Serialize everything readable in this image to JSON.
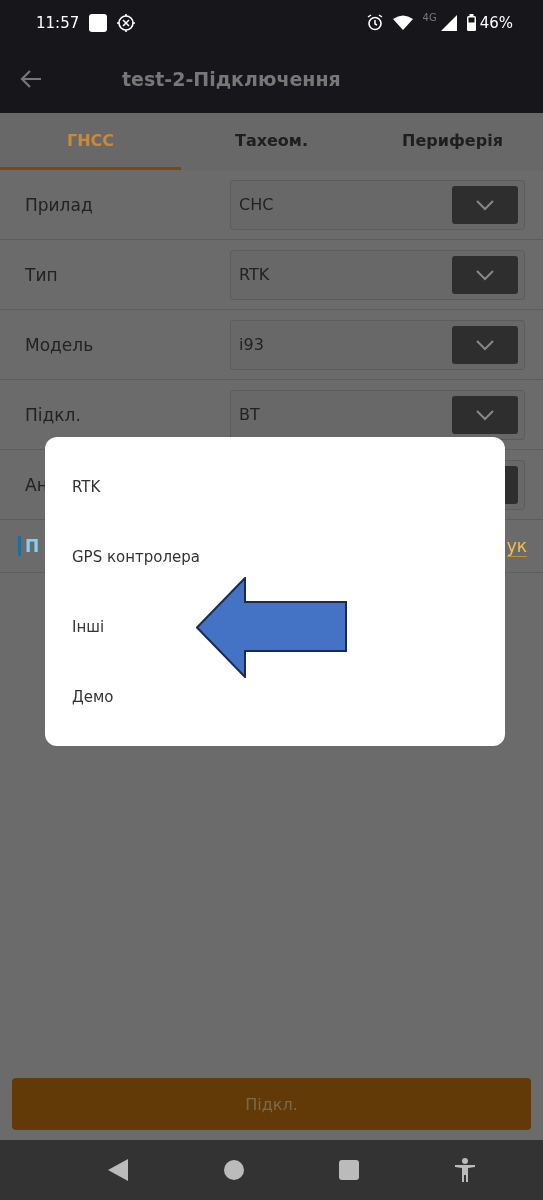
{
  "status_bar": {
    "time": "11:57",
    "network": "4G",
    "battery": "46%"
  },
  "app_bar": {
    "title": "test-2-Підключення"
  },
  "tabs": [
    {
      "label": "ГНСС",
      "selected": true
    },
    {
      "label": "Тахеом.",
      "selected": false
    },
    {
      "label": "Периферія",
      "selected": false
    }
  ],
  "fields": [
    {
      "label": "Прилад",
      "value": "CHC"
    },
    {
      "label": "Тип",
      "value": "RTK"
    },
    {
      "label": "Модель",
      "value": "i93"
    },
    {
      "label": "Підкл.",
      "value": "BT"
    },
    {
      "label": "Ан"
    }
  ],
  "link_row": {
    "left": "П",
    "right": "ук"
  },
  "dialog": {
    "options": [
      "RTK",
      "GPS контролера",
      "Інші",
      "Демо"
    ]
  },
  "connect_button": "Підкл."
}
